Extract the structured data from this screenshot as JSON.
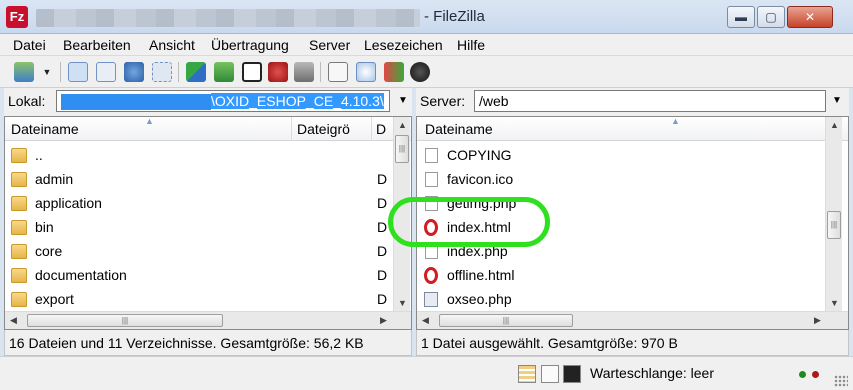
{
  "window": {
    "title_suffix": "- FileZilla",
    "app_icon_letters": "Fz",
    "min_glyph": "▬",
    "max_glyph": "▢",
    "close_glyph": "✕"
  },
  "menu": [
    "Datei",
    "Bearbeiten",
    "Ansicht",
    "Übertragung",
    "Server",
    "Lesezeichen",
    "Hilfe"
  ],
  "toolbar": {
    "icons": [
      "site-manager-icon",
      "message-log-icon",
      "local-tree-icon",
      "remote-tree-icon",
      "queue-icon",
      "refresh-icon",
      "process-queue-icon",
      "cancel-icon",
      "disconnect-icon",
      "reconnect-icon",
      "filter-icon",
      "compare-icon",
      "sync-browse-icon",
      "search-icon"
    ],
    "dropdown_glyph": "▼"
  },
  "local": {
    "path_label": "Lokal:",
    "path_value": "\\OXID_ESHOP_CE_4.10.3\\",
    "columns": [
      "Dateiname",
      "Dateigrö",
      "D"
    ],
    "rows": [
      {
        "name": "..",
        "type": ""
      },
      {
        "name": "admin",
        "type": "D"
      },
      {
        "name": "application",
        "type": "D"
      },
      {
        "name": "bin",
        "type": "D"
      },
      {
        "name": "core",
        "type": "D"
      },
      {
        "name": "documentation",
        "type": "D"
      },
      {
        "name": "export",
        "type": "D"
      }
    ],
    "status": "16 Dateien und 11 Verzeichnisse. Gesamtgröße: 56,2 KB"
  },
  "remote": {
    "path_label": "Server:",
    "path_value": "/web",
    "columns": [
      "Dateiname"
    ],
    "rows": [
      {
        "name": "COPYING",
        "icon": "file"
      },
      {
        "name": "favicon.ico",
        "icon": "file"
      },
      {
        "name": "getimg.php",
        "icon": "file"
      },
      {
        "name": "index.html",
        "icon": "opera"
      },
      {
        "name": "index.php",
        "icon": "file"
      },
      {
        "name": "offline.html",
        "icon": "opera"
      },
      {
        "name": "oxseo.php",
        "icon": "php"
      }
    ],
    "status": "1 Datei ausgewählt. Gesamtgröße: 970 B"
  },
  "scroll_glyphs": {
    "up": "▲",
    "down": "▼",
    "left": "◀",
    "right": "▶",
    "grip": "|||"
  },
  "queue": {
    "label": "Warteschlange: leer"
  },
  "colors": {
    "highlight_ring": "#2ee01e",
    "led_green": "#1f8a1f",
    "led_red": "#b01616"
  }
}
